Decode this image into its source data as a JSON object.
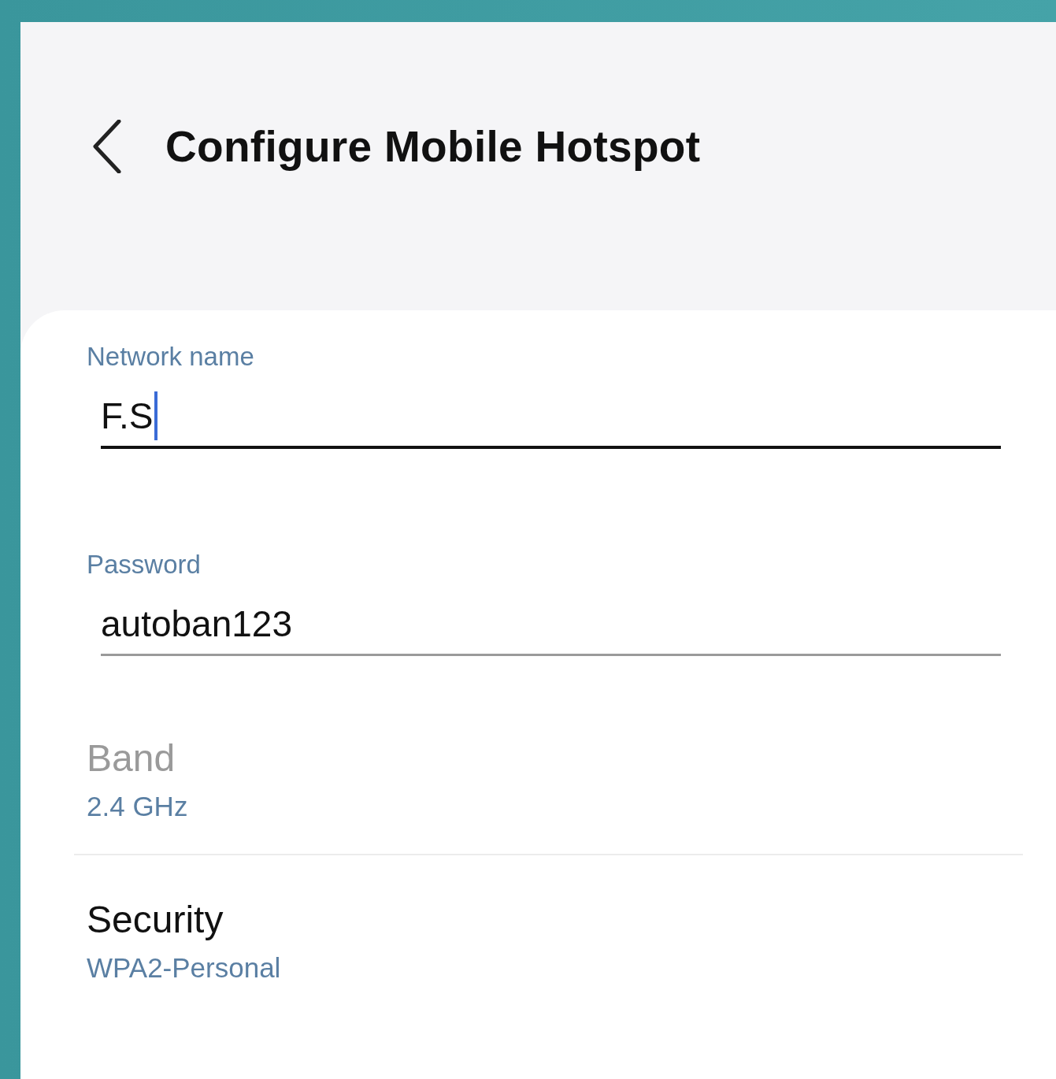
{
  "header": {
    "title": "Configure Mobile Hotspot"
  },
  "fields": [
    {
      "label": "Network name",
      "value": "F.S",
      "focused": true
    },
    {
      "label": "Password",
      "value": "autoban123",
      "focused": false
    }
  ],
  "settings": [
    {
      "title": "Band",
      "value": "2.4 GHz",
      "disabled": true
    },
    {
      "title": "Security",
      "value": "WPA2-Personal",
      "disabled": false
    }
  ]
}
